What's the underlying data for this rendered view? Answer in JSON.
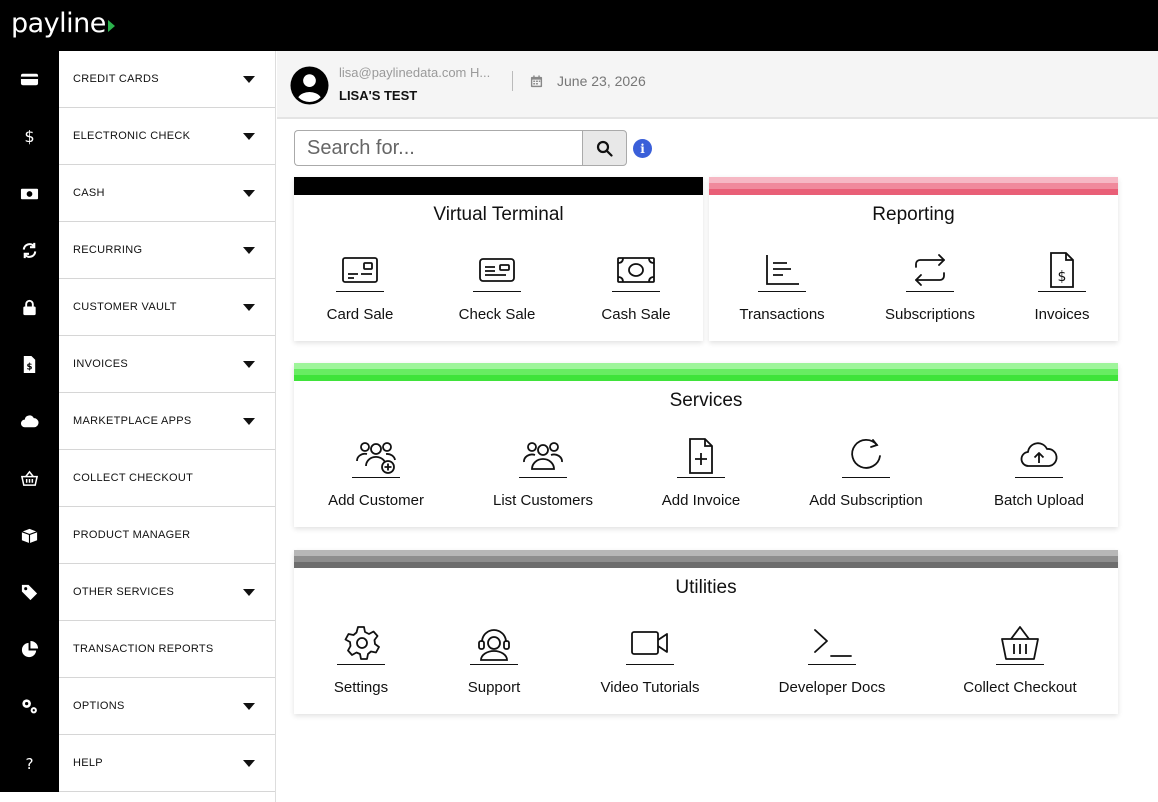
{
  "brand": {
    "logo_text": "payline"
  },
  "sidebar": {
    "items": [
      {
        "label": "CREDIT CARDS",
        "icon": "credit-card-icon",
        "has_caret": true
      },
      {
        "label": "ELECTRONIC CHECK",
        "icon": "dollar-icon",
        "has_caret": true
      },
      {
        "label": "CASH",
        "icon": "cash-icon",
        "has_caret": true
      },
      {
        "label": "RECURRING",
        "icon": "recurring-icon",
        "has_caret": true
      },
      {
        "label": "CUSTOMER VAULT",
        "icon": "lock-icon",
        "has_caret": true
      },
      {
        "label": "INVOICES",
        "icon": "invoice-icon",
        "has_caret": true
      },
      {
        "label": "MARKETPLACE APPS",
        "icon": "cloud-icon",
        "has_caret": true
      },
      {
        "label": "COLLECT CHECKOUT",
        "icon": "basket-icon",
        "has_caret": false
      },
      {
        "label": "PRODUCT MANAGER",
        "icon": "box-icon",
        "has_caret": false
      },
      {
        "label": "OTHER SERVICES",
        "icon": "tags-icon",
        "has_caret": true
      },
      {
        "label": "TRANSACTION REPORTS",
        "icon": "pie-chart-icon",
        "has_caret": false
      },
      {
        "label": "OPTIONS",
        "icon": "gears-icon",
        "has_caret": true
      },
      {
        "label": "HELP",
        "icon": "question-icon",
        "has_caret": true
      }
    ]
  },
  "header": {
    "email": "lisa@paylinedata.com H...",
    "account": "LISA'S TEST",
    "date": "June 23, 2026"
  },
  "search": {
    "placeholder": "Search for...",
    "info": "i"
  },
  "cards": {
    "virtual_terminal": {
      "title": "Virtual Terminal",
      "tiles": [
        "Card Sale",
        "Check Sale",
        "Cash Sale"
      ]
    },
    "reporting": {
      "title": "Reporting",
      "tiles": [
        "Transactions",
        "Subscriptions",
        "Invoices"
      ]
    },
    "services": {
      "title": "Services",
      "tiles": [
        "Add Customer",
        "List Customers",
        "Add Invoice",
        "Add Subscription",
        "Batch Upload"
      ]
    },
    "utilities": {
      "title": "Utilities",
      "tiles": [
        "Settings",
        "Support",
        "Video Tutorials",
        "Developer Docs",
        "Collect Checkout"
      ]
    }
  },
  "colors": {
    "virtual_terminal_bar": "#000000",
    "reporting_bar": "#e95f77",
    "services_bar": "#3fe33a",
    "utilities_bar": "#6d6d6d",
    "info_icon": "#3a5fd9"
  }
}
